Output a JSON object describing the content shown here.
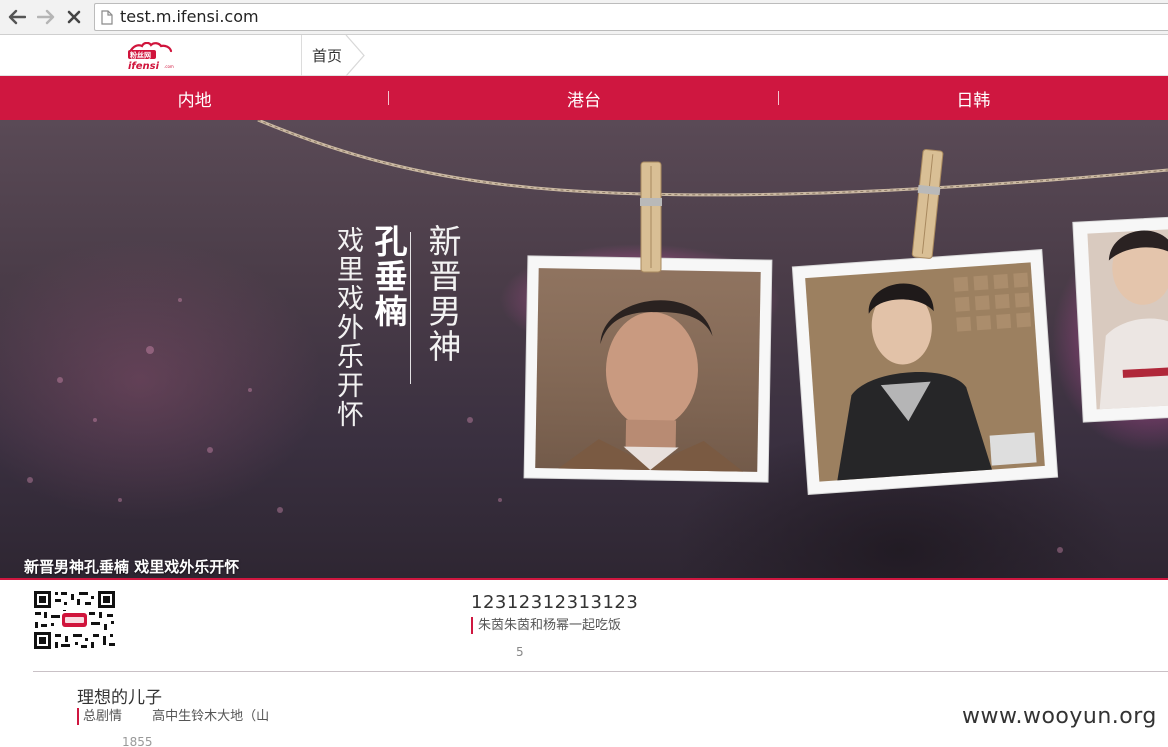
{
  "browser": {
    "url": "test.m.ifensi.com"
  },
  "header": {
    "logo_text": "粉丝网",
    "logo_sub": "ifensi",
    "breadcrumb": "首页"
  },
  "nav": {
    "items": [
      {
        "label": "内地"
      },
      {
        "label": "港台"
      },
      {
        "label": "日韩"
      }
    ]
  },
  "banner": {
    "caption": "新晋男神孔垂楠 戏里戏外乐开怀",
    "vertical_title": "新晋男神",
    "vertical_name": "孔垂楠",
    "vertical_subtitle": "戏里戏外乐开怀"
  },
  "list": {
    "items": [
      {
        "title": "12312312313123",
        "desc": "朱茵朱茵和杨幂一起吃饭",
        "count": "5"
      },
      {
        "title": "理想的儿子",
        "tag": "总剧情",
        "desc": "高中生铃木大地（山",
        "count": "1855"
      }
    ]
  },
  "watermark": "www.wooyun.org",
  "colors": {
    "brand": "#cf1740"
  }
}
